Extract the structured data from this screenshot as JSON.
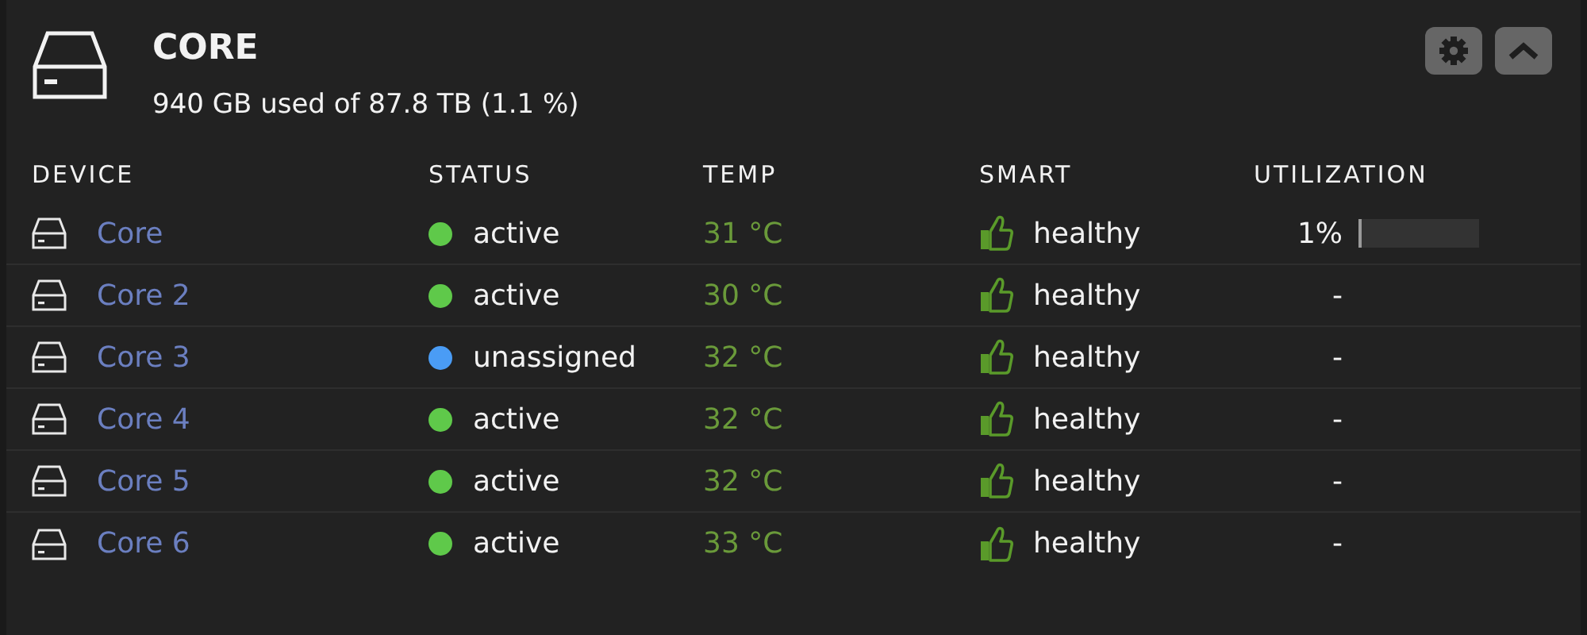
{
  "pool": {
    "title": "CORE",
    "usage": "940 GB used of 87.8 TB (1.1 %)"
  },
  "table": {
    "columns": [
      "DEVICE",
      "STATUS",
      "TEMP",
      "SMART",
      "UTILIZATION"
    ],
    "rows": [
      {
        "device": "Core",
        "status": "active",
        "color": "#5fc94a",
        "temp": "31 °C",
        "smart": "healthy",
        "utilization": "1%",
        "level": 0.01
      },
      {
        "device": "Core 2",
        "status": "active",
        "color": "#5fc94a",
        "temp": "30 °C",
        "smart": "healthy",
        "utilization": "-"
      },
      {
        "device": "Core 3",
        "status": "unassigned",
        "color": "#4a9cf5",
        "temp": "32 °C",
        "smart": "healthy",
        "utilization": "-"
      },
      {
        "device": "Core 4",
        "status": "active",
        "color": "#5fc94a",
        "temp": "32 °C",
        "smart": "healthy",
        "utilization": "-"
      },
      {
        "device": "Core 5",
        "status": "active",
        "color": "#5fc94a",
        "temp": "32 °C",
        "smart": "healthy",
        "utilization": "-"
      },
      {
        "device": "Core 6",
        "status": "active",
        "color": "#5fc94a",
        "temp": "33 °C",
        "smart": "healthy",
        "utilization": "-"
      }
    ]
  }
}
